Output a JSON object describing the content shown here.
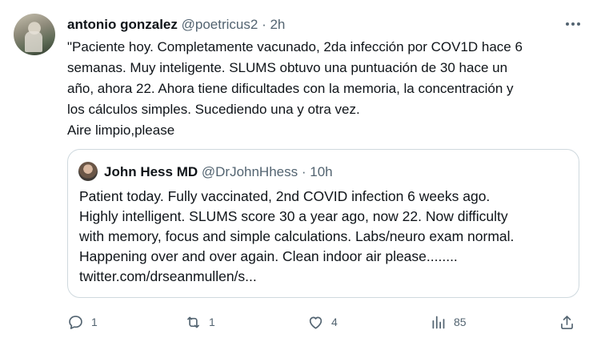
{
  "tweet": {
    "author_name": "antonio gonzalez",
    "handle": "@poetricus2",
    "separator": "·",
    "time": "2h",
    "text_lines": [
      "\"Paciente hoy. Completamente vacunado, 2da infección por COV1D hace 6",
      "semanas. Muy inteligente. SLUMS obtuvo una puntuación de 30 hace un",
      "año, ahora 22. Ahora tiene dificultades con la memoria, la concentración y",
      "los cálculos simples. Sucediendo una y otra vez.",
      "Aire limpio,please"
    ]
  },
  "quoted": {
    "author_name": "John Hess MD",
    "handle": "@DrJohnHhess",
    "separator": "·",
    "time": "10h",
    "text_lines": [
      "Patient today. Fully vaccinated, 2nd COVID infection 6 weeks ago.",
      "Highly intelligent. SLUMS score 30 a year ago, now 22. Now difficulty",
      "with memory, focus and simple calculations. Labs/neuro exam normal.",
      "Happening over and over again.  Clean indoor air  please........",
      "twitter.com/drseanmullen/s..."
    ]
  },
  "actions": {
    "reply_count": "1",
    "retweet_count": "1",
    "like_count": "4",
    "views_count": "85"
  },
  "icons": {
    "more": "more-dots-icon",
    "reply": "reply-bubble-icon",
    "retweet": "retweet-icon",
    "like": "heart-icon",
    "views": "views-bars-icon",
    "share": "share-upload-icon"
  },
  "colors": {
    "text": "#0f1419",
    "muted": "#536471",
    "border": "#cfd9de"
  }
}
